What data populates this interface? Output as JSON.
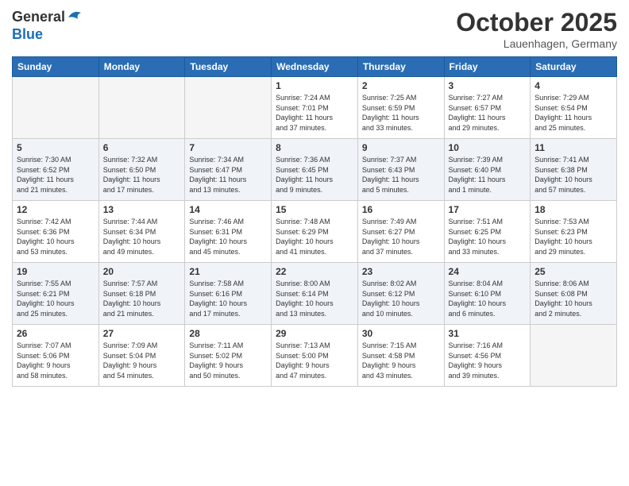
{
  "header": {
    "logo_line1": "General",
    "logo_line2": "Blue",
    "month": "October 2025",
    "location": "Lauenhagen, Germany"
  },
  "weekdays": [
    "Sunday",
    "Monday",
    "Tuesday",
    "Wednesday",
    "Thursday",
    "Friday",
    "Saturday"
  ],
  "weeks": [
    [
      {
        "day": "",
        "info": ""
      },
      {
        "day": "",
        "info": ""
      },
      {
        "day": "",
        "info": ""
      },
      {
        "day": "1",
        "info": "Sunrise: 7:24 AM\nSunset: 7:01 PM\nDaylight: 11 hours\nand 37 minutes."
      },
      {
        "day": "2",
        "info": "Sunrise: 7:25 AM\nSunset: 6:59 PM\nDaylight: 11 hours\nand 33 minutes."
      },
      {
        "day": "3",
        "info": "Sunrise: 7:27 AM\nSunset: 6:57 PM\nDaylight: 11 hours\nand 29 minutes."
      },
      {
        "day": "4",
        "info": "Sunrise: 7:29 AM\nSunset: 6:54 PM\nDaylight: 11 hours\nand 25 minutes."
      }
    ],
    [
      {
        "day": "5",
        "info": "Sunrise: 7:30 AM\nSunset: 6:52 PM\nDaylight: 11 hours\nand 21 minutes."
      },
      {
        "day": "6",
        "info": "Sunrise: 7:32 AM\nSunset: 6:50 PM\nDaylight: 11 hours\nand 17 minutes."
      },
      {
        "day": "7",
        "info": "Sunrise: 7:34 AM\nSunset: 6:47 PM\nDaylight: 11 hours\nand 13 minutes."
      },
      {
        "day": "8",
        "info": "Sunrise: 7:36 AM\nSunset: 6:45 PM\nDaylight: 11 hours\nand 9 minutes."
      },
      {
        "day": "9",
        "info": "Sunrise: 7:37 AM\nSunset: 6:43 PM\nDaylight: 11 hours\nand 5 minutes."
      },
      {
        "day": "10",
        "info": "Sunrise: 7:39 AM\nSunset: 6:40 PM\nDaylight: 11 hours\nand 1 minute."
      },
      {
        "day": "11",
        "info": "Sunrise: 7:41 AM\nSunset: 6:38 PM\nDaylight: 10 hours\nand 57 minutes."
      }
    ],
    [
      {
        "day": "12",
        "info": "Sunrise: 7:42 AM\nSunset: 6:36 PM\nDaylight: 10 hours\nand 53 minutes."
      },
      {
        "day": "13",
        "info": "Sunrise: 7:44 AM\nSunset: 6:34 PM\nDaylight: 10 hours\nand 49 minutes."
      },
      {
        "day": "14",
        "info": "Sunrise: 7:46 AM\nSunset: 6:31 PM\nDaylight: 10 hours\nand 45 minutes."
      },
      {
        "day": "15",
        "info": "Sunrise: 7:48 AM\nSunset: 6:29 PM\nDaylight: 10 hours\nand 41 minutes."
      },
      {
        "day": "16",
        "info": "Sunrise: 7:49 AM\nSunset: 6:27 PM\nDaylight: 10 hours\nand 37 minutes."
      },
      {
        "day": "17",
        "info": "Sunrise: 7:51 AM\nSunset: 6:25 PM\nDaylight: 10 hours\nand 33 minutes."
      },
      {
        "day": "18",
        "info": "Sunrise: 7:53 AM\nSunset: 6:23 PM\nDaylight: 10 hours\nand 29 minutes."
      }
    ],
    [
      {
        "day": "19",
        "info": "Sunrise: 7:55 AM\nSunset: 6:21 PM\nDaylight: 10 hours\nand 25 minutes."
      },
      {
        "day": "20",
        "info": "Sunrise: 7:57 AM\nSunset: 6:18 PM\nDaylight: 10 hours\nand 21 minutes."
      },
      {
        "day": "21",
        "info": "Sunrise: 7:58 AM\nSunset: 6:16 PM\nDaylight: 10 hours\nand 17 minutes."
      },
      {
        "day": "22",
        "info": "Sunrise: 8:00 AM\nSunset: 6:14 PM\nDaylight: 10 hours\nand 13 minutes."
      },
      {
        "day": "23",
        "info": "Sunrise: 8:02 AM\nSunset: 6:12 PM\nDaylight: 10 hours\nand 10 minutes."
      },
      {
        "day": "24",
        "info": "Sunrise: 8:04 AM\nSunset: 6:10 PM\nDaylight: 10 hours\nand 6 minutes."
      },
      {
        "day": "25",
        "info": "Sunrise: 8:06 AM\nSunset: 6:08 PM\nDaylight: 10 hours\nand 2 minutes."
      }
    ],
    [
      {
        "day": "26",
        "info": "Sunrise: 7:07 AM\nSunset: 5:06 PM\nDaylight: 9 hours\nand 58 minutes."
      },
      {
        "day": "27",
        "info": "Sunrise: 7:09 AM\nSunset: 5:04 PM\nDaylight: 9 hours\nand 54 minutes."
      },
      {
        "day": "28",
        "info": "Sunrise: 7:11 AM\nSunset: 5:02 PM\nDaylight: 9 hours\nand 50 minutes."
      },
      {
        "day": "29",
        "info": "Sunrise: 7:13 AM\nSunset: 5:00 PM\nDaylight: 9 hours\nand 47 minutes."
      },
      {
        "day": "30",
        "info": "Sunrise: 7:15 AM\nSunset: 4:58 PM\nDaylight: 9 hours\nand 43 minutes."
      },
      {
        "day": "31",
        "info": "Sunrise: 7:16 AM\nSunset: 4:56 PM\nDaylight: 9 hours\nand 39 minutes."
      },
      {
        "day": "",
        "info": ""
      }
    ]
  ]
}
